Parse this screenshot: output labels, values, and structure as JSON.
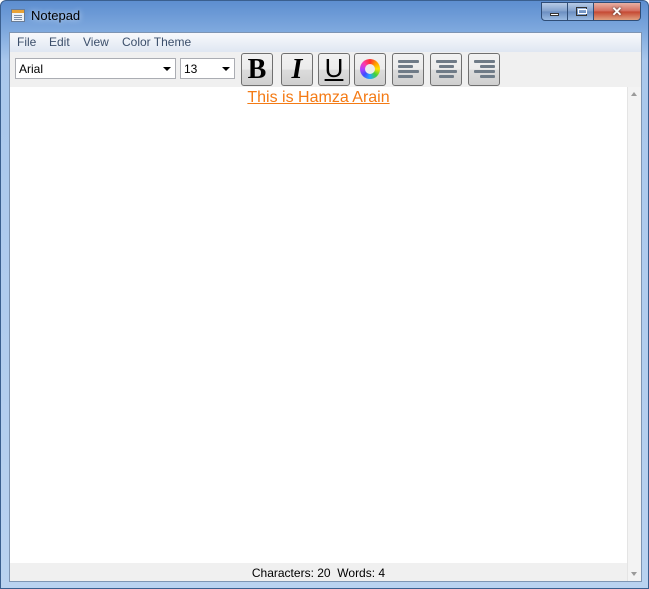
{
  "window": {
    "title": "Notepad",
    "close_glyph": "✕",
    "icon": "notepad-icon"
  },
  "menu": {
    "items": [
      "File",
      "Edit",
      "View",
      "Color Theme"
    ]
  },
  "toolbar": {
    "font_family": "Arial",
    "font_size": "13",
    "bold_label": "B",
    "italic_label": "I",
    "underline_label": "U",
    "color_icon": "color-wheel-icon",
    "align_icons": [
      "align-left-icon",
      "align-center-icon",
      "align-right-icon"
    ]
  },
  "editor": {
    "text": "This is Hamza Arain",
    "text_color": "#f47a14"
  },
  "status": {
    "characters_label": "Characters:",
    "characters": "20",
    "words_label": "Words:",
    "words": "4"
  }
}
